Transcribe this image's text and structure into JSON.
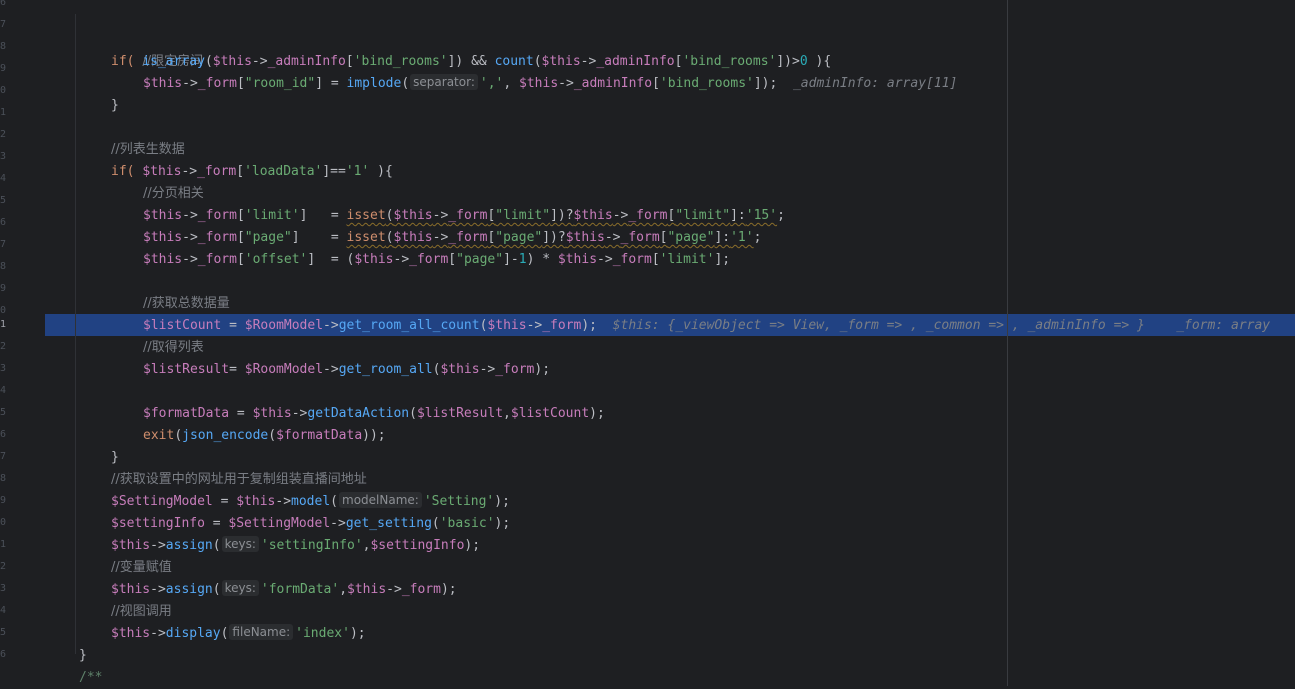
{
  "gutter": {
    "line_numbers": [
      "6",
      "7",
      "8",
      "9",
      "0",
      "1",
      "2",
      "3",
      "4",
      "5",
      "6",
      "7",
      "8",
      "9",
      "0",
      "1",
      "2",
      "3",
      "4",
      "5",
      "6",
      "7",
      "8",
      "9",
      "0",
      "1",
      "2",
      "3",
      "4",
      "5",
      "6"
    ]
  },
  "lines": {
    "l1": "//限定房间",
    "l2_if": "if(",
    "l2_fn1": "is_array",
    "l2_a": "(",
    "l2_var1": "$this",
    "l2_b": "->",
    "l2_prop1": "_adminInfo",
    "l2_c": "[",
    "l2_str1": "'bind_rooms'",
    "l2_d": "]) && ",
    "l2_fn2": "count",
    "l2_e": "(",
    "l2_var2": "$this",
    "l2_f": "->",
    "l2_prop2": "_adminInfo",
    "l2_g": "[",
    "l2_str2": "'bind_rooms'",
    "l2_h": "])>",
    "l2_num": "0",
    "l2_i": " ){",
    "l3_var1": "$this",
    "l3_a": "->",
    "l3_prop1": "_form",
    "l3_b": "[",
    "l3_str1": "\"room_id\"",
    "l3_c": "] = ",
    "l3_fn": "implode",
    "l3_d": "(",
    "l3_hint": "separator:",
    "l3_str2": "','",
    "l3_e": ", ",
    "l3_var2": "$this",
    "l3_f": "->",
    "l3_prop2": "_adminInfo",
    "l3_g": "[",
    "l3_str3": "'bind_rooms'",
    "l3_h": "]);",
    "l3_inlay": "_adminInfo: array[11]",
    "l4": "}",
    "l6": "//列表生数据",
    "l7_if": "if(",
    "l7_var": "$this",
    "l7_a": "->",
    "l7_prop": "_form",
    "l7_b": "[",
    "l7_str1": "'loadData'",
    "l7_c": "]==",
    "l7_str2": "'1'",
    "l7_d": " ){",
    "l8": "//分页相关",
    "l9_var1": "$this",
    "l9_a": "->",
    "l9_prop1": "_form",
    "l9_b": "[",
    "l9_str1": "'limit'",
    "l9_c": "]   = ",
    "l9_fn": "isset",
    "l9_d": "(",
    "l9_var2": "$this",
    "l9_e": "->",
    "l9_prop2": "_form",
    "l9_f": "[",
    "l9_str2": "\"limit\"",
    "l9_g": "])?",
    "l9_var3": "$this",
    "l9_h": "->",
    "l9_prop3": "_form",
    "l9_i": "[",
    "l9_str3": "\"limit\"",
    "l9_j": "]:",
    "l9_str4": "'15'",
    "l9_k": ";",
    "l10_var1": "$this",
    "l10_a": "->",
    "l10_prop1": "_form",
    "l10_b": "[",
    "l10_str1": "\"page\"",
    "l10_c": "]    = ",
    "l10_fn": "isset",
    "l10_d": "(",
    "l10_var2": "$this",
    "l10_e": "->",
    "l10_prop2": "_form",
    "l10_f": "[",
    "l10_str2": "\"page\"",
    "l10_g": "])?",
    "l10_var3": "$this",
    "l10_h": "->",
    "l10_prop3": "_form",
    "l10_i": "[",
    "l10_str3": "\"page\"",
    "l10_j": "]:",
    "l10_str4": "'1'",
    "l10_k": ";",
    "l11_var1": "$this",
    "l11_a": "->",
    "l11_prop1": "_form",
    "l11_b": "[",
    "l11_str1": "'offset'",
    "l11_c": "]  = (",
    "l11_var2": "$this",
    "l11_d": "->",
    "l11_prop2": "_form",
    "l11_e": "[",
    "l11_str2": "\"page\"",
    "l11_f": "]-",
    "l11_num": "1",
    "l11_g": ") * ",
    "l11_var3": "$this",
    "l11_h": "->",
    "l11_prop3": "_form",
    "l11_i": "[",
    "l11_str3": "'limit'",
    "l11_j": "];",
    "l13": "//获取总数据量",
    "l14_var1": "$listCount",
    "l14_a": " = ",
    "l14_var2": "$RoomModel",
    "l14_b": "->",
    "l14_fn": "get_room_all_count",
    "l14_c": "(",
    "l14_var3": "$this",
    "l14_d": "->",
    "l14_prop": "_form",
    "l14_e": ");",
    "l14_inlay1": "$this: {_viewObject => View, _form => , _common => , _adminInfo => }",
    "l14_inlay2": "_form: array",
    "l15": "//取得列表",
    "l16_var1": "$listResult",
    "l16_a": "= ",
    "l16_var2": "$RoomModel",
    "l16_b": "->",
    "l16_fn": "get_room_all",
    "l16_c": "(",
    "l16_var3": "$this",
    "l16_d": "->",
    "l16_prop": "_form",
    "l16_e": ");",
    "l18_var1": "$formatData",
    "l18_a": " = ",
    "l18_var2": "$this",
    "l18_b": "->",
    "l18_fn": "getDataAction",
    "l18_c": "(",
    "l18_var3": "$listResult",
    "l18_d": ",",
    "l18_var4": "$listCount",
    "l18_e": ");",
    "l19_kw": "exit",
    "l19_a": "(",
    "l19_fn": "json_encode",
    "l19_b": "(",
    "l19_var": "$formatData",
    "l19_c": "));",
    "l20": "}",
    "l21": "//获取设置中的网址用于复制组装直播间地址",
    "l22_var1": "$SettingModel",
    "l22_a": " = ",
    "l22_var2": "$this",
    "l22_b": "->",
    "l22_fn": "model",
    "l22_c": "(",
    "l22_hint": "modelName:",
    "l22_str": "'Setting'",
    "l22_d": ");",
    "l23_var1": "$settingInfo",
    "l23_a": " = ",
    "l23_var2": "$SettingModel",
    "l23_b": "->",
    "l23_fn": "get_setting",
    "l23_c": "(",
    "l23_str": "'basic'",
    "l23_d": ");",
    "l24_var1": "$this",
    "l24_a": "->",
    "l24_fn": "assign",
    "l24_b": "(",
    "l24_hint": "keys:",
    "l24_str": "'settingInfo'",
    "l24_c": ",",
    "l24_var2": "$settingInfo",
    "l24_d": ");",
    "l25": "//变量赋值",
    "l26_var1": "$this",
    "l26_a": "->",
    "l26_fn": "assign",
    "l26_b": "(",
    "l26_hint": "keys:",
    "l26_str": "'formData'",
    "l26_c": ",",
    "l26_var2": "$this",
    "l26_d": "->",
    "l26_prop": "_form",
    "l26_e": ");",
    "l27": "//视图调用",
    "l28_var": "$this",
    "l28_a": "->",
    "l28_fn": "display",
    "l28_b": "(",
    "l28_hint": "fileName:",
    "l28_str": "'index'",
    "l28_c": ");",
    "l29": "}",
    "l30": "/**"
  }
}
